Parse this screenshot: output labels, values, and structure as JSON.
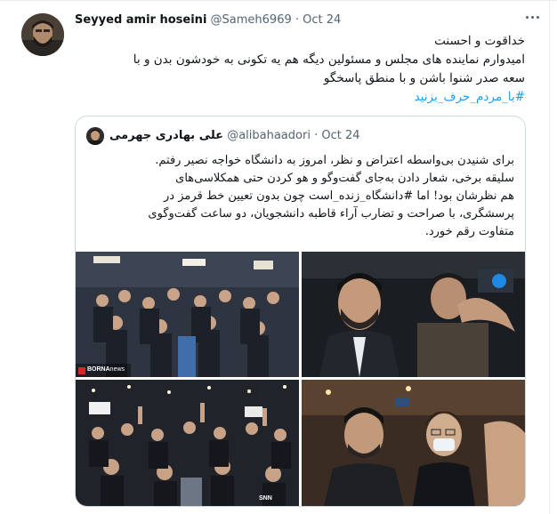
{
  "tweet": {
    "author_name": "Seyyed amir hoseini",
    "author_handle": "@Sameh6969",
    "separator": "·",
    "date": "Oct 24",
    "lines": [
      "خداقوت و احسنت",
      "امیدوارم نماینده های مجلس و مسئولین دیگه هم یه تکونی به خودشون بدن و با",
      "سعه صدر شنوا باشن و با منطق پاسخگو"
    ],
    "hashtag": "#با_مردم_حرف_بزنید"
  },
  "quoted": {
    "author_name": "علی بهادری جهرمی",
    "author_handle": "@alibahaadori",
    "separator": "·",
    "date": "Oct 24",
    "lines": [
      "برای شنیدن بی‌واسطه اعتراض و نظر، امروز به دانشگاه خواجه نصیر رفتم.",
      "سلیقه برخی، شعار دادن به‌جای گفت‌وگو و هو کردن حتی همکلاسی‌های",
      "هم نظرشان بود! اما #دانشگاه_زنده_است چون بدون تعیین خط قرمز در",
      "پرسشگری، با صراحت و تضارب آراء قاطبه دانشجویان، دو ساعت گفت‌وگوی",
      "متفاوت رقم خورد."
    ]
  },
  "media": {
    "photo1_watermark": "BORNA",
    "photo1_watermark_suffix": "news",
    "photo3_watermark": "SNN"
  },
  "colors": {
    "text": "#0f1419",
    "secondary": "#536471",
    "accent": "#1d9bf0",
    "border": "#cfd9de"
  },
  "icons": [
    "more-icon"
  ]
}
